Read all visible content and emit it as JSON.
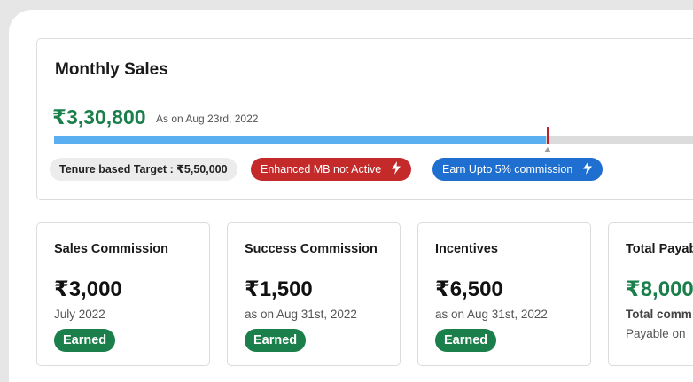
{
  "monthly_sales": {
    "title": "Monthly Sales",
    "amount": "₹3,30,800",
    "as_of": "As on Aug 23rd, 2022",
    "progress_fraction": 0.75,
    "badges": {
      "target": "Tenure based Target : ₹5,50,000",
      "enhanced_mb": "Enhanced MB not Active",
      "earn_upto": "Earn Upto 5% commission"
    }
  },
  "cards": {
    "sales_commission": {
      "title": "Sales Commission",
      "value": "₹3,000",
      "sub": "July 2022",
      "status": "Earned"
    },
    "success_commission": {
      "title": "Success Commission",
      "value": "₹1,500",
      "sub": "as on Aug 31st, 2022",
      "status": "Earned"
    },
    "incentives": {
      "title": "Incentives",
      "value": "₹6,500",
      "sub": "as on Aug 31st, 2022",
      "status": "Earned"
    },
    "total_payable": {
      "title": "Total Payable",
      "value": "₹8,000",
      "sub": "Total comm",
      "sub2": "Payable on"
    }
  },
  "colors": {
    "accent_green": "#1a7f4b",
    "progress_blue": "#5aaff0",
    "alert_red": "#c42a2a",
    "info_blue": "#1f6fd0"
  }
}
